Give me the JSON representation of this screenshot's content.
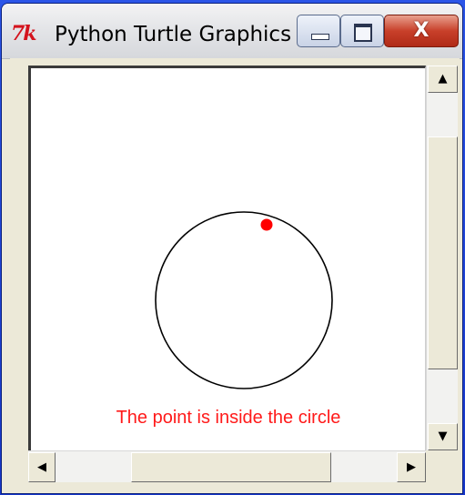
{
  "window": {
    "title": "Python Turtle Graphics",
    "icon": "tk-feather-icon",
    "icon_text": "7k",
    "buttons": {
      "minimize": "minimize-icon",
      "maximize": "maximize-icon",
      "close": "close-icon",
      "close_glyph": "X"
    }
  },
  "canvas": {
    "background": "#ffffff",
    "circle_color": "#000000",
    "point_color": "#ff0000",
    "result_text": "The point is inside the circle",
    "result_color": "#ff1a1a"
  },
  "scrollbars": {
    "up_arrow": "▲",
    "down_arrow": "▼",
    "left_arrow": "◀",
    "right_arrow": "▶"
  }
}
